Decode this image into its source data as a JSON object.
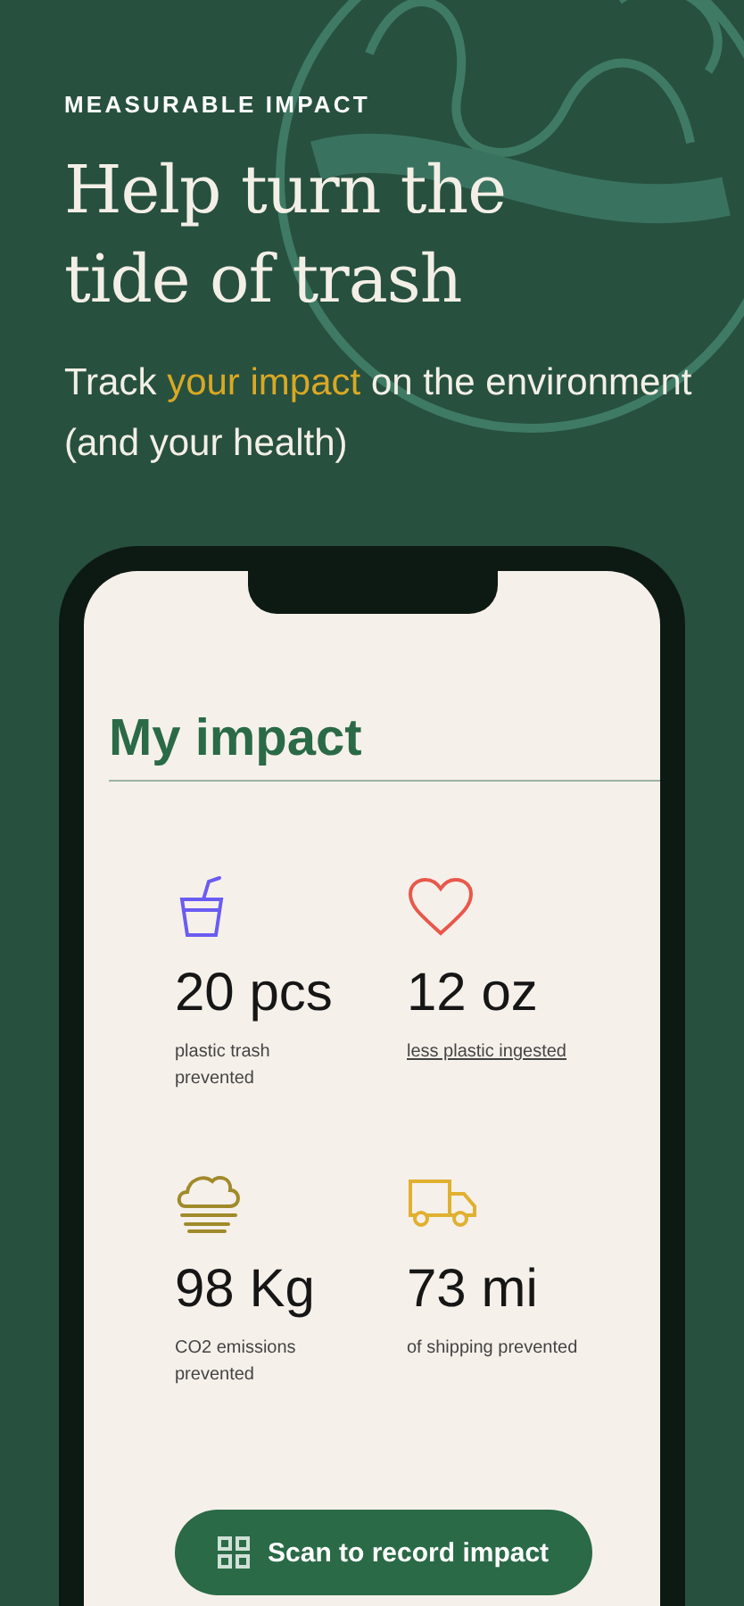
{
  "eyebrow": "MEASURABLE IMPACT",
  "headline": "Help turn the tide of trash",
  "subtitle": "Track **your impact** on the environment (and your health)",
  "phone": {
    "title": "My impact",
    "stats": [
      {
        "kind": "cup",
        "value": "20 pcs",
        "caption": "plastic trash prevented",
        "link": false
      },
      {
        "kind": "heart",
        "value": "12 oz",
        "caption": "less plastic ingested",
        "link": true
      },
      {
        "kind": "cloud",
        "value": "98 Kg",
        "caption": "CO2 emissions prevented",
        "link": false
      },
      {
        "kind": "truck",
        "value": "73 mi",
        "caption": "of shipping prevented",
        "link": false
      }
    ],
    "button": "Scan to record impact"
  }
}
